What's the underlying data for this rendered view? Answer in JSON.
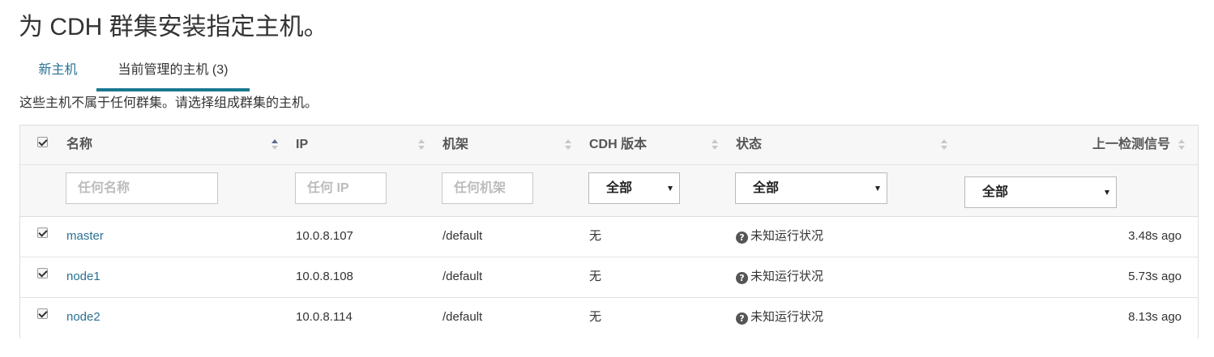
{
  "page": {
    "title": "为 CDH 群集安装指定主机。",
    "subtitle": "这些主机不属于任何群集。请选择组成群集的主机。"
  },
  "tabs": [
    {
      "label": "新主机",
      "active": false
    },
    {
      "label": "当前管理的主机 (3)",
      "active": true
    }
  ],
  "table": {
    "select_all_checked": true,
    "columns": {
      "name": "名称",
      "ip": "IP",
      "rack": "机架",
      "cdh": "CDH 版本",
      "status": "状态",
      "last_heartbeat": "上一检测信号"
    },
    "filters": {
      "name_placeholder": "任何名称",
      "ip_placeholder": "任何 IP",
      "rack_placeholder": "任何机架",
      "cdh_value": "全部",
      "status_value": "全部",
      "last_value": "全部"
    },
    "rows": [
      {
        "checked": true,
        "name": "master",
        "ip": "10.0.8.107",
        "rack": "/default",
        "cdh": "无",
        "status": "未知运行状况",
        "last": "3.48s ago"
      },
      {
        "checked": true,
        "name": "node1",
        "ip": "10.0.8.108",
        "rack": "/default",
        "cdh": "无",
        "status": "未知运行状况",
        "last": "5.73s ago"
      },
      {
        "checked": true,
        "name": "node2",
        "ip": "10.0.8.114",
        "rack": "/default",
        "cdh": "无",
        "status": "未知运行状况",
        "last": "8.13s ago"
      }
    ]
  },
  "icons": {
    "status": "question-circle-icon",
    "checkbox": "checkbox-checked-icon",
    "sort": "sort-arrows-icon"
  },
  "colors": {
    "link": "#2a7193",
    "active_tab_underline": "#1b7891",
    "header_bg": "#f7f7f7"
  }
}
